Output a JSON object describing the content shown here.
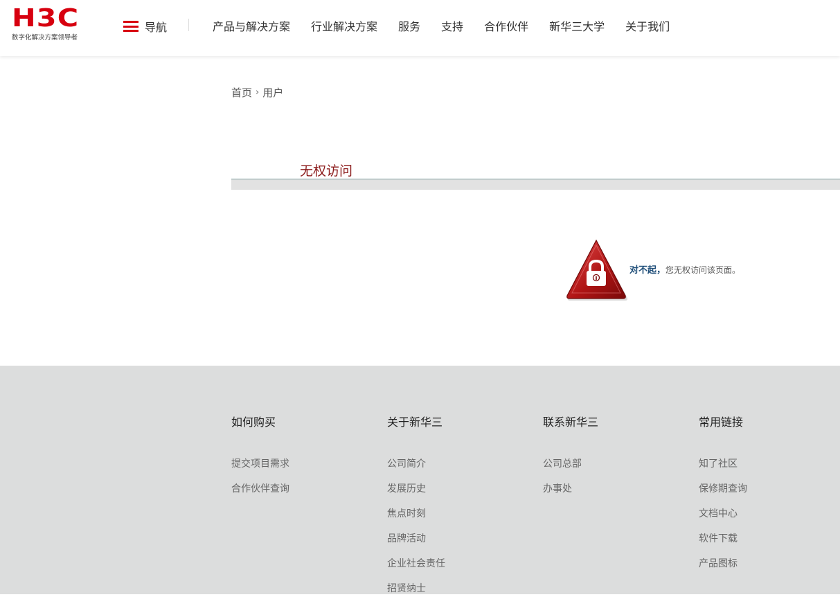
{
  "header": {
    "logo_text": "H3C",
    "logo_tagline": "数字化解决方案领导者",
    "nav_toggle_label": "导航",
    "menu": [
      "产品与解决方案",
      "行业解决方案",
      "服务",
      "支持",
      "合作伙伴",
      "新华三大学",
      "关于我们"
    ]
  },
  "breadcrumb": {
    "home": "首页",
    "separator": "›",
    "current": "用户"
  },
  "page": {
    "title": "无权访问",
    "message_strong": "对不起，",
    "message": "您无权访问该页面。"
  },
  "footer": {
    "columns": [
      {
        "heading": "如何购买",
        "links": [
          "提交项目需求",
          "合作伙伴查询"
        ]
      },
      {
        "heading": "关于新华三",
        "links": [
          "公司简介",
          "发展历史",
          "焦点时刻",
          "品牌活动",
          "企业社会责任",
          "招贤纳士"
        ]
      },
      {
        "heading": "联系新华三",
        "links": [
          "公司总部",
          "办事处"
        ]
      },
      {
        "heading": "常用链接",
        "links": [
          "知了社区",
          "保修期查询",
          "文档中心",
          "软件下载",
          "产品图标"
        ]
      }
    ]
  },
  "icons": {
    "menu": "hamburger-icon",
    "warning": "lock-warning-icon"
  },
  "colors": {
    "brand": "#d7000f",
    "title": "#8b1a1a",
    "footer_bg": "#dcdddd"
  }
}
